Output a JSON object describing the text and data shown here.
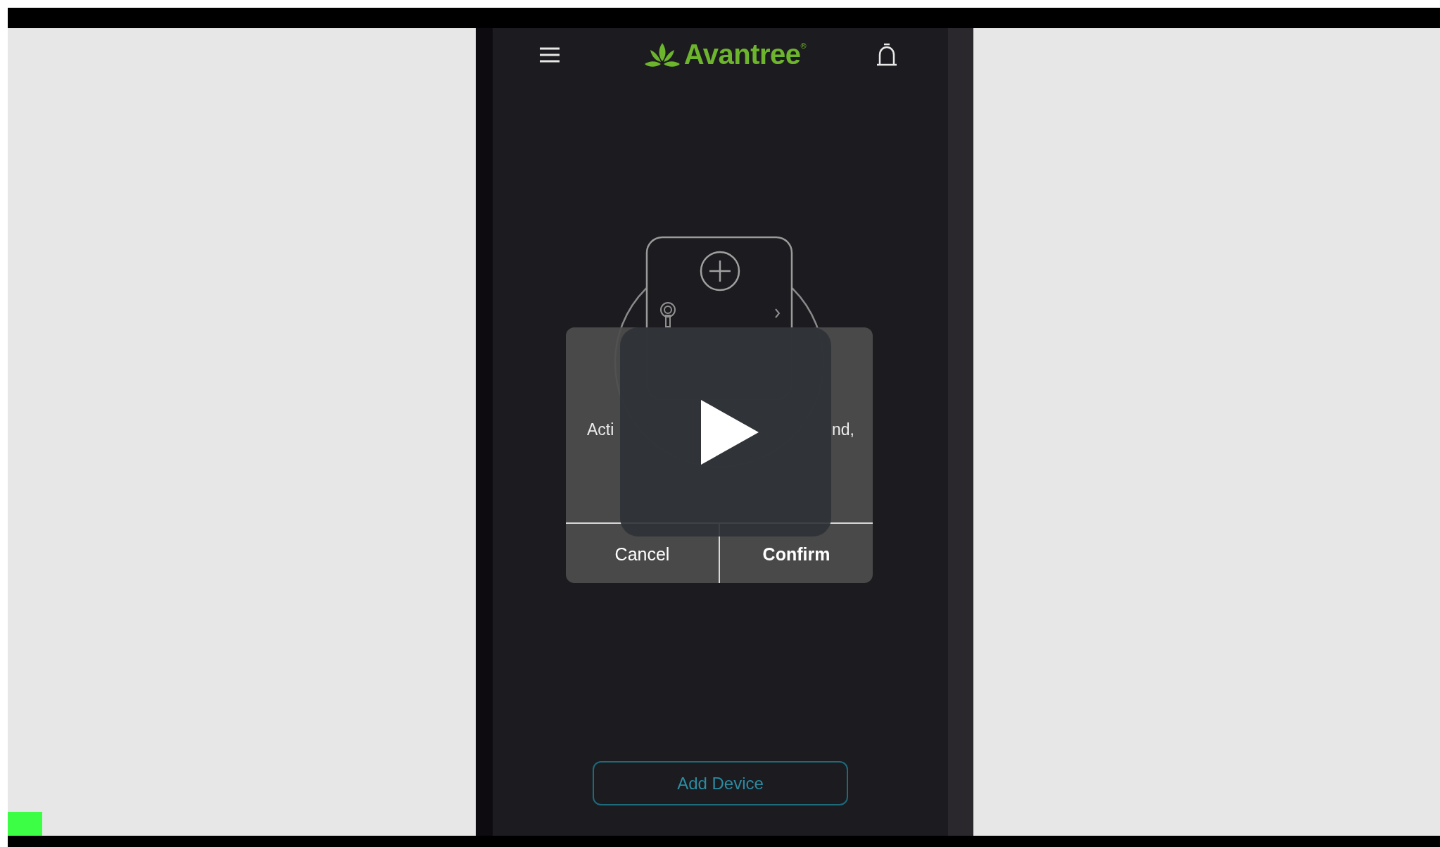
{
  "app": {
    "header": {
      "logo": "Avantree",
      "logo_mark": "®"
    },
    "add_button": "Add Device"
  },
  "dialog": {
    "message_parts": [
      "Acti",
      "nd,"
    ],
    "buttons": [
      {
        "label": "Cancel",
        "kind": "cancel"
      },
      {
        "label": "Confirm",
        "kind": "confirm"
      }
    ]
  },
  "player": {
    "paused": true
  }
}
